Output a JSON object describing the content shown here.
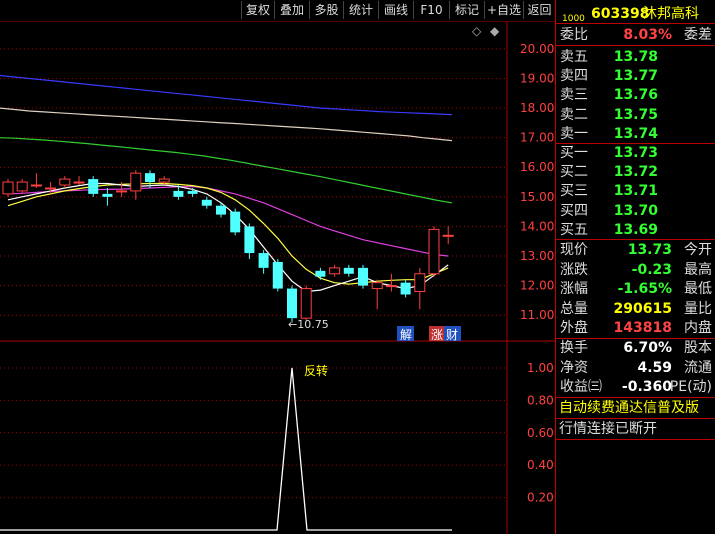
{
  "toolbar": {
    "buttons": [
      "复权",
      "叠加",
      "多股",
      "统计",
      "画线",
      "F10",
      "标记",
      "+自选",
      "返回"
    ]
  },
  "header": {
    "code_prefix": "1000",
    "code": "603398",
    "name": "沐邦高科"
  },
  "order_book": {
    "weibi_label": "委比",
    "weibi_value": "8.03%",
    "weicha_label": "委差",
    "sells": [
      {
        "label": "卖五",
        "price": "13.78"
      },
      {
        "label": "卖四",
        "price": "13.77"
      },
      {
        "label": "卖三",
        "price": "13.76"
      },
      {
        "label": "卖二",
        "price": "13.75"
      },
      {
        "label": "卖一",
        "price": "13.74"
      }
    ],
    "buys": [
      {
        "label": "买一",
        "price": "13.73"
      },
      {
        "label": "买二",
        "price": "13.72"
      },
      {
        "label": "买三",
        "price": "13.71"
      },
      {
        "label": "买四",
        "price": "13.70"
      },
      {
        "label": "买五",
        "price": "13.69"
      }
    ]
  },
  "quote": {
    "rows": [
      {
        "label": "现价",
        "value": "13.73",
        "ext": "今开",
        "color": "green"
      },
      {
        "label": "涨跌",
        "value": "-0.23",
        "ext": "最高",
        "color": "green"
      },
      {
        "label": "涨幅",
        "value": "-1.65%",
        "ext": "最低",
        "color": "green"
      },
      {
        "label": "总量",
        "value": "290615",
        "ext": "量比",
        "color": "yellow"
      },
      {
        "label": "外盘",
        "value": "143818",
        "ext": "内盘",
        "color": "red"
      }
    ],
    "rows2": [
      {
        "label": "换手",
        "value": "6.70%",
        "ext": "股本",
        "color": "white"
      },
      {
        "label": "净资",
        "value": "4.59",
        "ext": "流通",
        "color": "white"
      },
      {
        "label": "收益㈢",
        "value": "-0.360",
        "ext": "PE(动)",
        "color": "white"
      }
    ],
    "notice1": "自动续费通达信普及版",
    "notice2": "行情连接已断开"
  },
  "chart_data": {
    "type": "candlestick",
    "price_axis": [
      "20.00",
      "19.00",
      "18.00",
      "17.00",
      "16.00",
      "15.00",
      "14.00",
      "13.00",
      "12.00",
      "11.00"
    ],
    "ylim": [
      10.5,
      20.3
    ],
    "low_marker": "←10.75",
    "tags": [
      "解",
      "涨",
      "财"
    ],
    "indicator_axis": [
      "1.00",
      "0.80",
      "0.60",
      "0.40",
      "0.20"
    ],
    "indicator_ylim": [
      0,
      1.08
    ],
    "signal_label": "反转",
    "signal_index": 20,
    "candles": [
      {
        "o": 15.1,
        "c": 15.5,
        "h": 15.6,
        "l": 15.0
      },
      {
        "o": 15.2,
        "c": 15.5,
        "h": 15.6,
        "l": 15.1
      },
      {
        "o": 15.4,
        "c": 15.4,
        "h": 15.8,
        "l": 15.3
      },
      {
        "o": 15.3,
        "c": 15.3,
        "h": 15.5,
        "l": 15.1
      },
      {
        "o": 15.4,
        "c": 15.6,
        "h": 15.7,
        "l": 15.3
      },
      {
        "o": 15.5,
        "c": 15.5,
        "h": 15.7,
        "l": 15.4
      },
      {
        "o": 15.6,
        "c": 15.1,
        "h": 15.7,
        "l": 15.0
      },
      {
        "o": 15.1,
        "c": 15.0,
        "h": 15.3,
        "l": 14.7
      },
      {
        "o": 15.2,
        "c": 15.2,
        "h": 15.5,
        "l": 15.0
      },
      {
        "o": 15.2,
        "c": 15.8,
        "h": 15.9,
        "l": 14.9
      },
      {
        "o": 15.8,
        "c": 15.5,
        "h": 15.9,
        "l": 15.3
      },
      {
        "o": 15.5,
        "c": 15.6,
        "h": 15.7,
        "l": 15.4
      },
      {
        "o": 15.2,
        "c": 15.0,
        "h": 15.4,
        "l": 14.9
      },
      {
        "o": 15.2,
        "c": 15.1,
        "h": 15.3,
        "l": 15.0
      },
      {
        "o": 14.9,
        "c": 14.7,
        "h": 15.0,
        "l": 14.6
      },
      {
        "o": 14.7,
        "c": 14.4,
        "h": 14.8,
        "l": 14.3
      },
      {
        "o": 14.5,
        "c": 13.8,
        "h": 14.6,
        "l": 13.7
      },
      {
        "o": 14.0,
        "c": 13.1,
        "h": 14.1,
        "l": 12.9
      },
      {
        "o": 13.1,
        "c": 12.6,
        "h": 13.2,
        "l": 12.4
      },
      {
        "o": 12.8,
        "c": 11.9,
        "h": 12.9,
        "l": 11.8
      },
      {
        "o": 11.9,
        "c": 10.9,
        "h": 12.0,
        "l": 10.75
      },
      {
        "o": 10.9,
        "c": 11.9,
        "h": 12.0,
        "l": 10.8
      },
      {
        "o": 12.5,
        "c": 12.3,
        "h": 12.6,
        "l": 12.2
      },
      {
        "o": 12.4,
        "c": 12.6,
        "h": 12.7,
        "l": 12.3
      },
      {
        "o": 12.6,
        "c": 12.4,
        "h": 12.7,
        "l": 12.3
      },
      {
        "o": 12.6,
        "c": 12.0,
        "h": 12.7,
        "l": 11.9
      },
      {
        "o": 11.9,
        "c": 12.1,
        "h": 12.2,
        "l": 11.2
      },
      {
        "o": 12.0,
        "c": 12.0,
        "h": 12.4,
        "l": 11.8
      },
      {
        "o": 12.1,
        "c": 11.7,
        "h": 12.2,
        "l": 11.6
      },
      {
        "o": 11.8,
        "c": 12.4,
        "h": 12.6,
        "l": 11.2
      },
      {
        "o": 12.4,
        "c": 13.9,
        "h": 14.0,
        "l": 12.3
      },
      {
        "o": 13.7,
        "c": 13.7,
        "h": 14.0,
        "l": 13.4
      }
    ],
    "ma_lines": [
      {
        "color": "#3a3aff",
        "values": [
          19.1,
          19.05,
          19.0,
          18.95,
          18.9,
          18.85,
          18.8,
          18.75,
          18.7,
          18.65,
          18.6,
          18.55,
          18.5,
          18.45,
          18.4,
          18.35,
          18.3,
          18.25,
          18.2,
          18.15,
          18.1,
          18.05,
          18.0,
          17.97,
          17.94,
          17.91,
          17.88,
          17.86,
          17.84,
          17.82,
          17.8,
          17.78
        ]
      },
      {
        "color": "#e0d0c0",
        "values": [
          18.0,
          17.95,
          17.9,
          17.87,
          17.84,
          17.81,
          17.78,
          17.75,
          17.72,
          17.69,
          17.66,
          17.63,
          17.6,
          17.57,
          17.54,
          17.51,
          17.48,
          17.45,
          17.42,
          17.39,
          17.36,
          17.33,
          17.3,
          17.26,
          17.22,
          17.18,
          17.14,
          17.1,
          17.06,
          17.0,
          16.95,
          16.9
        ]
      },
      {
        "color": "#3c3",
        "values": [
          17.0,
          16.98,
          16.95,
          16.92,
          16.88,
          16.84,
          16.8,
          16.75,
          16.7,
          16.65,
          16.6,
          16.55,
          16.5,
          16.44,
          16.38,
          16.3,
          16.22,
          16.13,
          16.04,
          15.95,
          15.86,
          15.77,
          15.68,
          15.58,
          15.48,
          15.38,
          15.28,
          15.18,
          15.08,
          14.98,
          14.88,
          14.8
        ]
      },
      {
        "color": "#e040e0",
        "values": [
          15.1,
          15.12,
          15.15,
          15.18,
          15.2,
          15.22,
          15.24,
          15.25,
          15.26,
          15.28,
          15.3,
          15.32,
          15.34,
          15.35,
          15.3,
          15.2,
          15.1,
          14.95,
          14.8,
          14.6,
          14.4,
          14.2,
          14.0,
          13.85,
          13.7,
          13.55,
          13.45,
          13.35,
          13.25,
          13.15,
          13.05,
          13.0
        ]
      },
      {
        "color": "#ffff40",
        "values": [
          14.7,
          14.85,
          15.0,
          15.1,
          15.2,
          15.28,
          15.35,
          15.4,
          15.42,
          15.44,
          15.45,
          15.45,
          15.42,
          15.38,
          15.3,
          15.15,
          14.9,
          14.55,
          14.1,
          13.6,
          13.0,
          12.55,
          12.25,
          12.1,
          12.05,
          12.1,
          12.15,
          12.18,
          12.2,
          12.2,
          12.4,
          12.6
        ]
      },
      {
        "color": "#ffffff",
        "values": [
          14.9,
          15.0,
          15.1,
          15.2,
          15.3,
          15.38,
          15.45,
          15.45,
          15.4,
          15.35,
          15.38,
          15.4,
          15.35,
          15.25,
          15.1,
          14.8,
          14.4,
          13.9,
          13.3,
          12.7,
          12.15,
          11.8,
          11.85,
          12.0,
          12.15,
          12.3,
          12.1,
          12.0,
          11.9,
          12.0,
          12.35,
          12.7
        ]
      }
    ]
  }
}
